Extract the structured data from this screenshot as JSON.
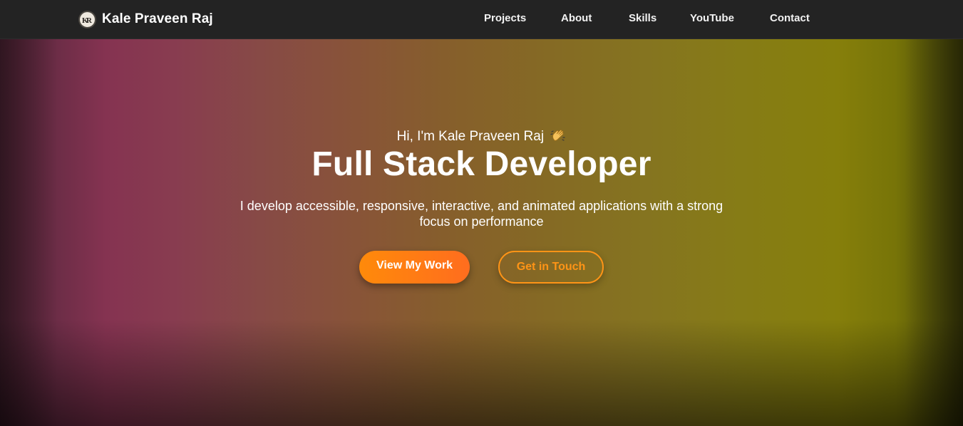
{
  "navbar": {
    "brand_name": "Kale Praveen Raj",
    "logo_icon": "kr-monogram-icon",
    "links": [
      {
        "label": "Projects"
      },
      {
        "label": "About"
      },
      {
        "label": "Skills"
      },
      {
        "label": "YouTube"
      },
      {
        "label": "Contact"
      }
    ]
  },
  "hero": {
    "greeting": "Hi, I'm Kale Praveen Raj",
    "greeting_icon": "waving-hand-icon",
    "headline": "Full Stack Developer",
    "tagline": "I develop accessible, responsive, interactive, and animated applications with a strong focus on performance",
    "primary_button": "View My Work",
    "secondary_button": "Get in Touch"
  },
  "colors": {
    "navbar_bg": "#232323",
    "accent_orange": "#ff8a0a",
    "hero_gradient_left": "#853351",
    "hero_gradient_right": "#867f0b"
  }
}
